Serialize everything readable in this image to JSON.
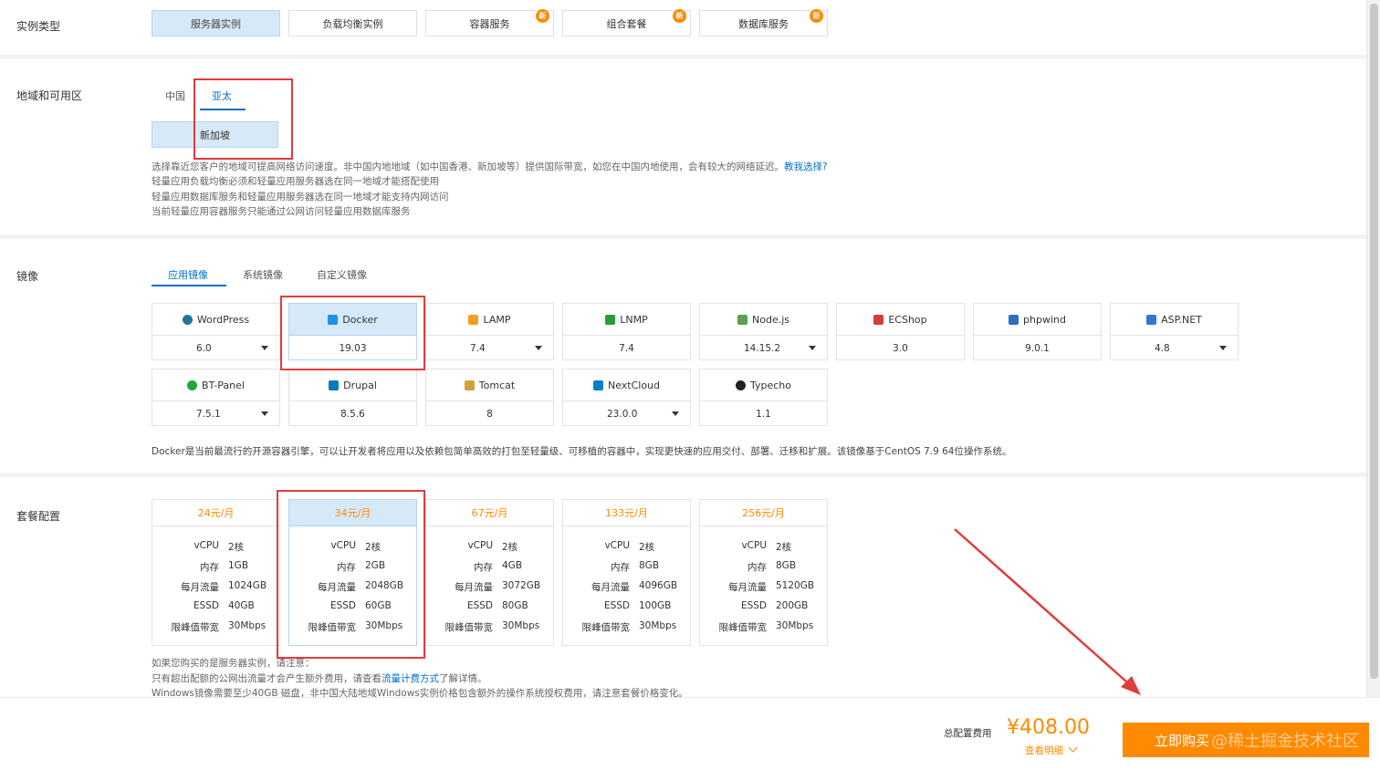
{
  "sections": {
    "instance_type": "实例类型",
    "region": "地域和可用区",
    "image": "镜像",
    "plan": "套餐配置"
  },
  "instance_types": [
    {
      "label": "服务器实例",
      "selected": true,
      "new": false
    },
    {
      "label": "负载均衡实例",
      "selected": false,
      "new": false
    },
    {
      "label": "容器服务",
      "selected": false,
      "new": true
    },
    {
      "label": "组合套餐",
      "selected": false,
      "new": true
    },
    {
      "label": "数据库服务",
      "selected": false,
      "new": true
    }
  ],
  "new_badge": "新",
  "region_tabs": [
    {
      "label": "中国",
      "active": false
    },
    {
      "label": "亚太",
      "active": true
    }
  ],
  "region_selected": "新加坡",
  "region_notes": {
    "line1": "选择靠近您客户的地域可提高网络访问速度。非中国内地地域（如中国香港、新加坡等）提供国际带宽，如您在中国内地使用，会有较大的网络延迟。",
    "line1_link": "教我选择?",
    "line2": "轻量应用负载均衡必须和轻量应用服务器选在同一地域才能搭配使用",
    "line3": "轻量应用数据库服务和轻量应用服务器选在同一地域才能支持内网访问",
    "line4": "当前轻量应用容器服务只能通过公网访问轻量应用数据库服务"
  },
  "image_tabs": [
    {
      "label": "应用镜像",
      "active": true
    },
    {
      "label": "系统镜像",
      "active": false
    },
    {
      "label": "自定义镜像",
      "active": false
    }
  ],
  "images": [
    {
      "name": "WordPress",
      "version": "6.0",
      "dropdown": true,
      "icon": "wordpress-icon",
      "color": "#21759b"
    },
    {
      "name": "Docker",
      "version": "19.03",
      "dropdown": false,
      "icon": "docker-icon",
      "color": "#1d91e6",
      "selected": true
    },
    {
      "name": "LAMP",
      "version": "7.4",
      "dropdown": true,
      "icon": "lamp-icon",
      "color": "#f0a020"
    },
    {
      "name": "LNMP",
      "version": "7.4",
      "dropdown": false,
      "icon": "lnmp-icon",
      "color": "#2a9d3a"
    },
    {
      "name": "Node.js",
      "version": "14.15.2",
      "dropdown": true,
      "icon": "nodejs-icon",
      "color": "#5fa04e"
    },
    {
      "name": "ECShop",
      "version": "3.0",
      "dropdown": false,
      "icon": "ecshop-icon",
      "color": "#d23c3c"
    },
    {
      "name": "phpwind",
      "version": "9.0.1",
      "dropdown": false,
      "icon": "phpwind-icon",
      "color": "#2d6fbf"
    },
    {
      "name": "ASP.NET",
      "version": "4.8",
      "dropdown": true,
      "icon": "aspnet-icon",
      "color": "#2b7bd4"
    },
    {
      "name": "BT-Panel",
      "version": "7.5.1",
      "dropdown": true,
      "icon": "btpanel-icon",
      "color": "#20a53a"
    },
    {
      "name": "Drupal",
      "version": "8.5.6",
      "dropdown": false,
      "icon": "drupal-icon",
      "color": "#0678be"
    },
    {
      "name": "Tomcat",
      "version": "8",
      "dropdown": false,
      "icon": "tomcat-icon",
      "color": "#d3a23d"
    },
    {
      "name": "NextCloud",
      "version": "23.0.0",
      "dropdown": true,
      "icon": "nextcloud-icon",
      "color": "#0082c9"
    },
    {
      "name": "Typecho",
      "version": "1.1",
      "dropdown": false,
      "icon": "typecho-icon",
      "color": "#222222"
    }
  ],
  "image_description": "Docker是当前最流行的开源容器引擎，可以让开发者将应用以及依赖包简单高效的打包至轻量级、可移植的容器中，实现更快速的应用交付、部署、迁移和扩展。该镜像基于CentOS 7.9 64位操作系统。",
  "spec_keys": [
    "vCPU",
    "内存",
    "每月流量",
    "ESSD",
    "限峰值带宽"
  ],
  "plans": [
    {
      "price": "24元/月",
      "values": [
        "2核",
        "1GB",
        "1024GB",
        "40GB",
        "30Mbps"
      ],
      "selected": false
    },
    {
      "price": "34元/月",
      "values": [
        "2核",
        "2GB",
        "2048GB",
        "60GB",
        "30Mbps"
      ],
      "selected": true
    },
    {
      "price": "67元/月",
      "values": [
        "2核",
        "4GB",
        "3072GB",
        "80GB",
        "30Mbps"
      ],
      "selected": false
    },
    {
      "price": "133元/月",
      "values": [
        "2核",
        "8GB",
        "4096GB",
        "100GB",
        "30Mbps"
      ],
      "selected": false
    },
    {
      "price": "256元/月",
      "values": [
        "2核",
        "8GB",
        "5120GB",
        "200GB",
        "30Mbps"
      ],
      "selected": false
    }
  ],
  "plan_notes": {
    "line1": "如果您购买的是服务器实例，请注意：",
    "line2_pre": "只有超出配额的公网出流量才会产生额外费用，请查看",
    "line2_link": "流量计费方式",
    "line2_post": "了解详情。",
    "line3": "Windows镜像需要至少40GB 磁盘，非中国大陆地域Windows实例价格包含额外的操作系统授权费用，请注意套餐价格变化。"
  },
  "footer": {
    "fee_label": "总配置费用",
    "fee_value": "¥408.00",
    "detail_label": "查看明细",
    "buy_label": "立即购买",
    "watermark": "@稀土掘金技术社区"
  },
  "colors": {
    "accent": "#0070cc",
    "price_orange": "#ff8a00",
    "selected_bg": "#d6e9f8",
    "annotation_red": "#e03c3c"
  }
}
